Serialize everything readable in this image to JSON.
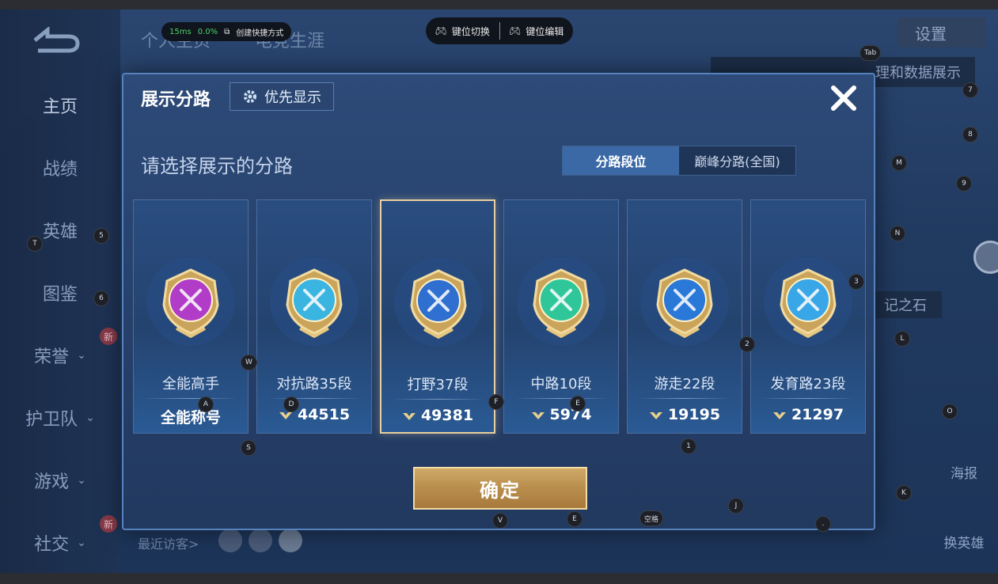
{
  "overlay": {
    "ping": "15ms",
    "loss": "0.0%",
    "shortcut_label": "创建快捷方式",
    "key_switch_label": "键位切换",
    "key_edit_label": "键位编辑"
  },
  "background": {
    "tabs": [
      "个人主页",
      "电竞生涯"
    ],
    "sidebar": [
      {
        "label": "主页"
      },
      {
        "label": "战绩"
      },
      {
        "label": "英雄"
      },
      {
        "label": "图鉴"
      },
      {
        "label": "荣誉"
      },
      {
        "label": "护卫队"
      },
      {
        "label": "游戏"
      },
      {
        "label": "社交"
      }
    ],
    "new_badge": "新",
    "visitors_label": "最近访客>",
    "settings_label": "设置",
    "tooltip_text": "理和数据展示",
    "stone_label": "记之石",
    "haibao_label": "海报",
    "change_hero_label": "换英雄"
  },
  "modal": {
    "title": "展示分路",
    "pref_button": "优先显示",
    "subtitle": "请选择展示的分路",
    "toggle": [
      "分路段位",
      "巅峰分路(全国)"
    ],
    "toggle_active": 0,
    "cards": [
      {
        "role": "全能高手",
        "score": "全能称号",
        "color": "#b13cc8",
        "icon": "all-round-emblem-icon",
        "has_mark": false
      },
      {
        "role": "对抗路35段",
        "score": "44515",
        "color": "#3ab4e0",
        "icon": "clash-lane-emblem-icon",
        "has_mark": true
      },
      {
        "role": "打野37段",
        "score": "49381",
        "color": "#2e6fd0",
        "icon": "jungle-emblem-icon",
        "has_mark": true
      },
      {
        "role": "中路10段",
        "score": "5974",
        "color": "#2fc79a",
        "icon": "mid-lane-emblem-icon",
        "has_mark": true
      },
      {
        "role": "游走22段",
        "score": "19195",
        "color": "#2a78d8",
        "icon": "roam-emblem-icon",
        "has_mark": true
      },
      {
        "role": "发育路23段",
        "score": "21297",
        "color": "#39a6e8",
        "icon": "farm-lane-emblem-icon",
        "has_mark": true
      }
    ],
    "selected_card": 2,
    "confirm_label": "确定"
  },
  "key_hints": [
    "Tab",
    "7",
    "8",
    "M",
    "9",
    "T",
    "5",
    "N",
    "3",
    "6",
    "2",
    "L",
    "W",
    "A",
    "D",
    "F",
    "E",
    "O",
    "S",
    "1",
    "J",
    "K",
    "V",
    "E",
    "空格",
    "."
  ]
}
